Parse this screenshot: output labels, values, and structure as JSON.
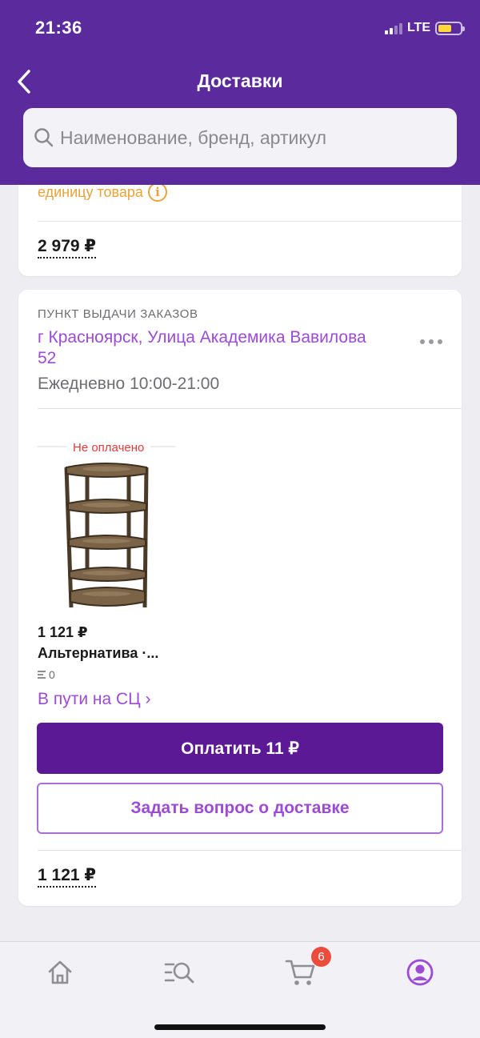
{
  "status_bar": {
    "time": "21:36",
    "network": "LTE"
  },
  "header": {
    "title": "Доставки"
  },
  "search": {
    "placeholder": "Наименование, бренд, артикул"
  },
  "card_prev": {
    "unit_text": "единицу товара",
    "total": "2 979 ₽"
  },
  "card_pickup": {
    "label": "ПУНКТ ВЫДАЧИ ЗАКАЗОВ",
    "address": "г Красноярск, Улица Академика Вавилова 52",
    "hours": "Ежедневно 10:00-21:00",
    "product": {
      "status": "Не оплачено",
      "price": "1 121 ₽",
      "name": "Альтернатива ·...",
      "count": "0",
      "transit": "В пути на СЦ ›"
    },
    "pay_button": "Оплатить 11 ₽",
    "ask_button": "Задать вопрос о доставке",
    "total": "1 121 ₽"
  },
  "tabbar": {
    "cart_badge": "6",
    "colors": {
      "inactive": "#8e8e93",
      "active": "#9c4bd6"
    }
  }
}
